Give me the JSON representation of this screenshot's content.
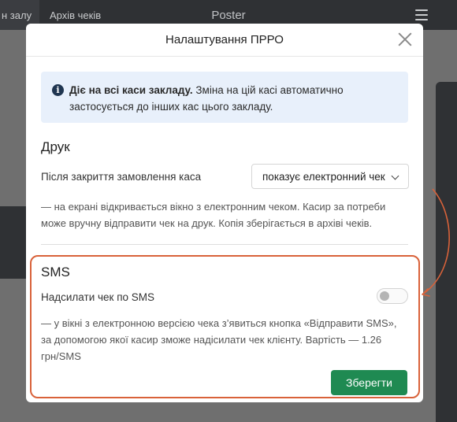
{
  "background": {
    "tabs": [
      "н залу",
      "Архів чеків"
    ],
    "app_title": "Poster"
  },
  "modal": {
    "title": "Налаштування ПРРО",
    "info": {
      "bold": "Діє на всі каси закладу.",
      "text": " Зміна на цій касі автоматично застосується до інших кас цього закладу."
    },
    "print": {
      "title": "Друк",
      "label": "Після закриття замовлення каса",
      "select_value": "показує електронний чек",
      "description": "— на екрані відкривається вікно з електронним чеком. Касир за потреби може вручну відправити чек на друк. Копія зберігається в архіві чеків."
    },
    "sms": {
      "title": "SMS",
      "label": "Надсилати чек по SMS",
      "enabled": false,
      "description": "— у вікні з електронною версією чека з’явиться кнопка «Відправити SMS», за допомогою якої касир зможе надісилати чек клієнту. Вартість — 1.26 грн/SMS"
    },
    "save_label": "Зберегти"
  },
  "colors": {
    "highlight": "#d9623a",
    "save_button": "#1f8a52",
    "info_background": "#e8f0fb",
    "topbar": "#2f3134"
  },
  "icons": {
    "info": "info-icon",
    "close": "close-icon",
    "menu": "menu-icon",
    "select": "chevron-down-icon"
  }
}
